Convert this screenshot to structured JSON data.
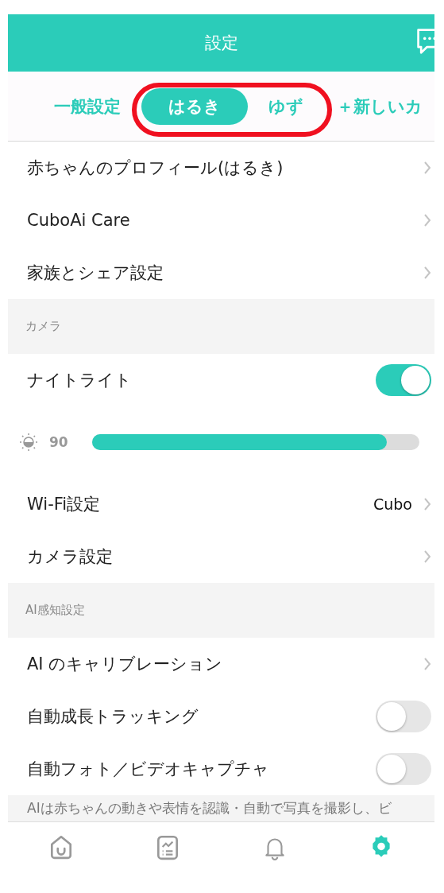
{
  "header": {
    "title": "設定"
  },
  "tabs": [
    {
      "label": "一般設定",
      "selected": false
    },
    {
      "label": "はるき",
      "selected": true
    },
    {
      "label": "ゆず",
      "selected": false
    },
    {
      "label": "＋新しいカ",
      "selected": false
    }
  ],
  "rows": [
    {
      "kind": "link",
      "label": "赤ちゃんのプロフィール(はるき)"
    },
    {
      "kind": "link",
      "label": "CuboAi Care"
    },
    {
      "kind": "link",
      "label": "家族とシェア設定"
    },
    {
      "kind": "section",
      "label": "カメラ"
    },
    {
      "kind": "toggle",
      "label": "ナイトライト",
      "on": true
    },
    {
      "kind": "slider",
      "reading": "90",
      "level": 0.9
    },
    {
      "kind": "link",
      "label": "Wi-Fi設定",
      "value": "Cubo"
    },
    {
      "kind": "link",
      "label": "カメラ設定"
    },
    {
      "kind": "section",
      "label": "AI感知設定"
    },
    {
      "kind": "link",
      "label": "AI のキャリブレーション"
    },
    {
      "kind": "toggle",
      "label": "自動成長トラッキング",
      "on": false
    },
    {
      "kind": "toggle",
      "label": "自動フォト／ビデオキャプチャ",
      "on": false
    },
    {
      "kind": "note",
      "label": "AIは赤ちゃんの動きや表情を認識・自動で写真を撮影し、ビ"
    }
  ],
  "tab_bar": [
    {
      "kind": "home",
      "selected": false
    },
    {
      "kind": "report",
      "selected": false
    },
    {
      "kind": "bell",
      "selected": false
    },
    {
      "kind": "gear",
      "selected": true
    }
  ]
}
